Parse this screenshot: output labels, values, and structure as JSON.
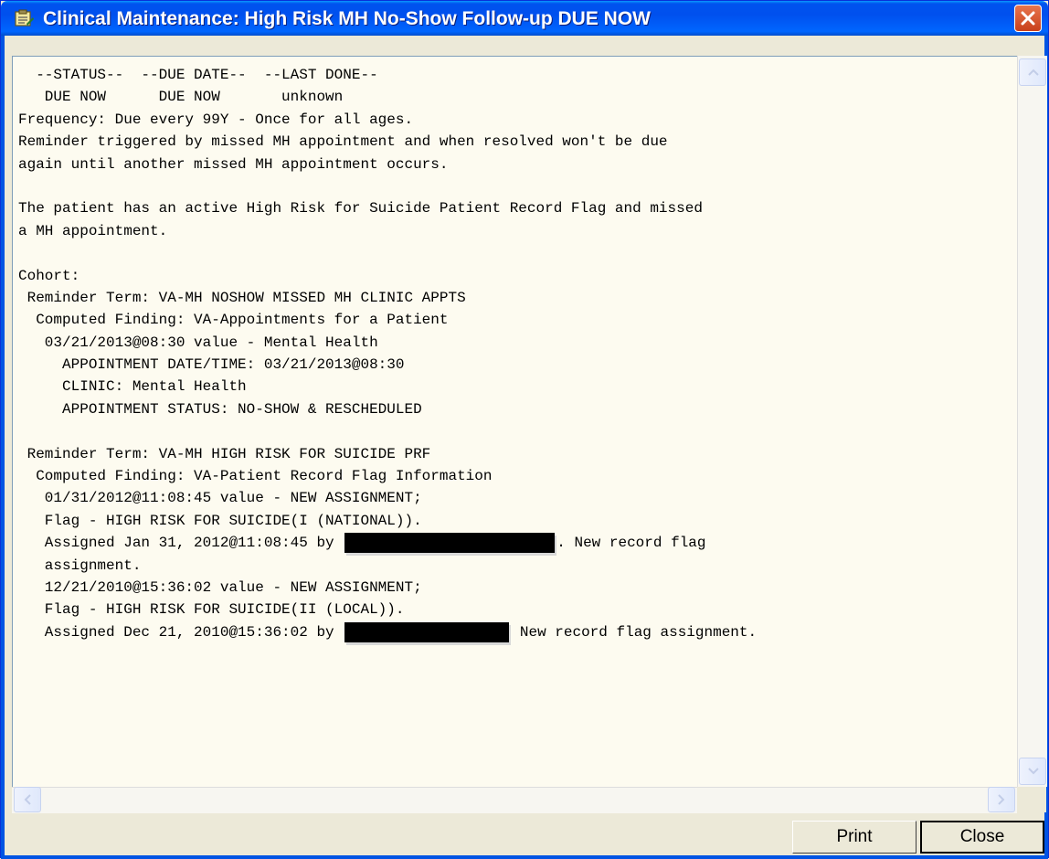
{
  "window": {
    "title": "Clinical Maintenance: High Risk MH No-Show Follow-up DUE NOW",
    "app_icon": "clipboard-icon",
    "close_glyph": "close-icon"
  },
  "report": {
    "lines": [
      "  --STATUS--  --DUE DATE--  --LAST DONE--",
      "   DUE NOW      DUE NOW       unknown",
      "Frequency: Due every 99Y - Once for all ages.",
      "Reminder triggered by missed MH appointment and when resolved won't be due",
      "again until another missed MH appointment occurs.",
      "",
      "The patient has an active High Risk for Suicide Patient Record Flag and missed",
      "a MH appointment.",
      "",
      "Cohort:",
      " Reminder Term: VA-MH NOSHOW MISSED MH CLINIC APPTS",
      "  Computed Finding: VA-Appointments for a Patient",
      "   03/21/2013@08:30 value - Mental Health",
      "     APPOINTMENT DATE/TIME: 03/21/2013@08:30",
      "     CLINIC: Mental Health",
      "     APPOINTMENT STATUS: NO-SHOW & RESCHEDULED",
      "",
      " Reminder Term: VA-MH HIGH RISK FOR SUICIDE PRF",
      "  Computed Finding: VA-Patient Record Flag Information",
      "   01/31/2012@11:08:45 value - NEW ASSIGNMENT;",
      "   Flag - HIGH RISK FOR SUICIDE(I (NATIONAL))."
    ],
    "line_assigned_1_prefix": "   Assigned Jan 31, 2012@11:08:45 by ",
    "line_assigned_1_suffix": ". New record flag",
    "line_assignment_cont": "   assignment.",
    "line_value_2": "   12/21/2010@15:36:02 value - NEW ASSIGNMENT;",
    "line_flag_2": "   Flag - HIGH RISK FOR SUICIDE(II (LOCAL)).",
    "line_assigned_2_prefix": "   Assigned Dec 21, 2010@15:36:02 by ",
    "line_assigned_2_suffix": " New record flag assignment."
  },
  "buttons": {
    "print_label": "Print",
    "close_label": "Close"
  }
}
